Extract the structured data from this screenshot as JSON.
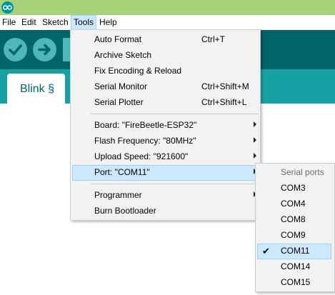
{
  "menubar": {
    "items": [
      {
        "label": "File"
      },
      {
        "label": "Edit"
      },
      {
        "label": "Sketch"
      },
      {
        "label": "Tools"
      },
      {
        "label": "Help"
      }
    ]
  },
  "toolbar": {
    "verify_icon": "checkmark-icon",
    "upload_icon": "arrow-right-icon"
  },
  "editor": {
    "tab_label": "Blink §"
  },
  "tools_menu": {
    "items": [
      {
        "label": "Auto Format",
        "shortcut": "Ctrl+T"
      },
      {
        "label": "Archive Sketch"
      },
      {
        "label": "Fix Encoding & Reload"
      },
      {
        "label": "Serial Monitor",
        "shortcut": "Ctrl+Shift+M"
      },
      {
        "label": "Serial Plotter",
        "shortcut": "Ctrl+Shift+L"
      },
      {
        "label": "Board: \"FireBeetle-ESP32\""
      },
      {
        "label": "Flash Frequency: \"80MHz\""
      },
      {
        "label": "Upload Speed: \"921600\""
      },
      {
        "label": "Port: \"COM11\""
      },
      {
        "label": "Programmer"
      },
      {
        "label": "Burn Bootloader"
      }
    ]
  },
  "ports_menu": {
    "header": "Serial ports",
    "ports": [
      "COM3",
      "COM4",
      "COM8",
      "COM9",
      "COM11",
      "COM14",
      "COM15"
    ],
    "selected": "COM11",
    "check_glyph": "✔"
  },
  "colors": {
    "titlebar": "#a8d27a",
    "toolbar": "#006468",
    "tabstrip": "#17a1a5",
    "button": "#4db7bb",
    "highlight": "#cce8ff"
  }
}
